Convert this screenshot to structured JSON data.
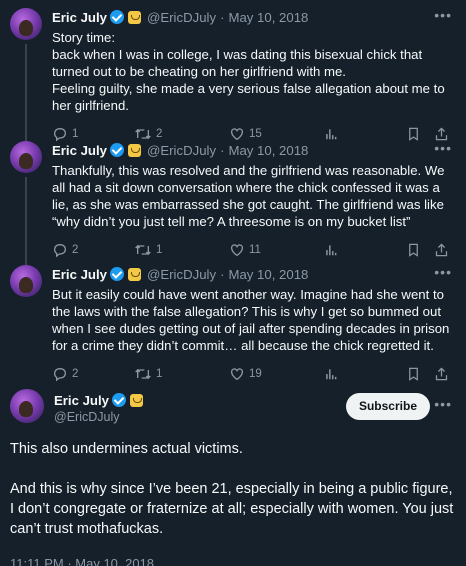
{
  "author": {
    "name": "Eric July",
    "handle": "@EricDJuly"
  },
  "tweets": [
    {
      "date": "May 10, 2018",
      "text": "Story time:\nback when I was in college, I was dating this bisexual chick that turned out to be cheating on her girlfriend with me.\nFeeling guilty, she made a very serious false allegation about me to her girlfriend.",
      "replies": "1",
      "retweets": "2",
      "likes": "15"
    },
    {
      "date": "May 10, 2018",
      "text": "Thankfully, this was resolved and the girlfriend was reasonable. We all had a sit down conversation where the chick confessed it was a lie, as she was embarrassed she got caught. The girlfriend was like “why didn’t you just tell me? A threesome is on my bucket list”",
      "replies": "2",
      "retweets": "1",
      "likes": "11"
    },
    {
      "date": "May 10, 2018",
      "text": "But it easily could have went another way. Imagine had she went to the laws with the false allegation? This is why I get so bummed out when I see dudes getting out of jail after spending decades in prison for a crime they didn’t commit… all because the chick regretted it.",
      "replies": "2",
      "retweets": "1",
      "likes": "19"
    }
  ],
  "main_tweet": {
    "subscribe_label": "Subscribe",
    "paragraph_1": "This also undermines actual victims.",
    "paragraph_2": "And this is why since I’ve been 21, especially in being a public figure, I don’t congregate or fraternize at all; especially with women. You just can’t trust mothafuckas.",
    "timestamp": "11:11 PM · May 10, 2018"
  },
  "separator": "·",
  "icons": {
    "reply": "reply-icon",
    "retweet": "retweet-icon",
    "like": "heart-icon",
    "views": "views-icon",
    "bookmark": "bookmark-icon",
    "share": "share-icon",
    "more": "more-icon",
    "verified": "verified-badge-icon",
    "affiliate": "affiliate-badge-icon"
  },
  "colors": {
    "background": "#15202b",
    "text": "#f7f9f9",
    "muted": "#8b98a5",
    "verified": "#1d9bf0"
  }
}
